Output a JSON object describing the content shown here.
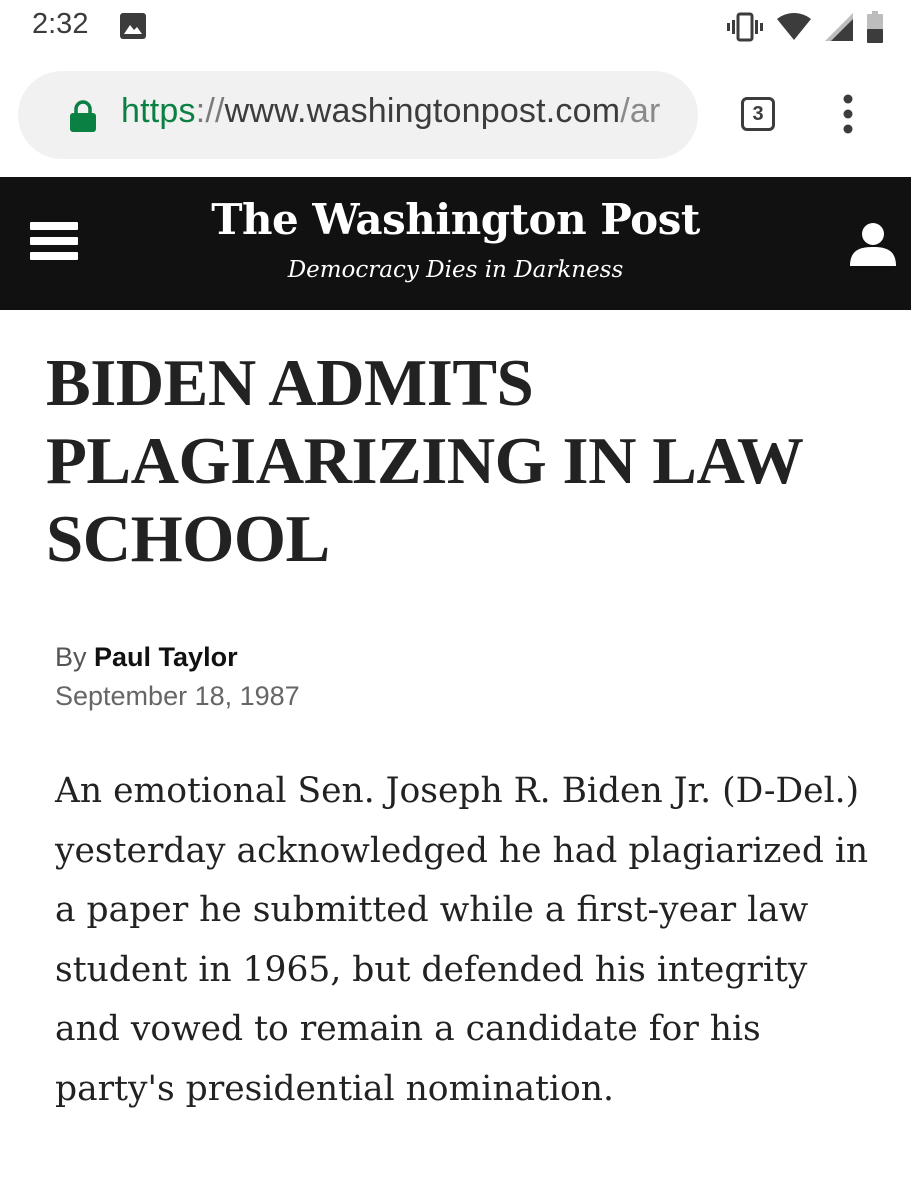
{
  "status_bar": {
    "time": "2:32",
    "icons": [
      "image-notification-icon",
      "vibrate-icon",
      "wifi-icon",
      "cell-signal-icon",
      "battery-icon"
    ]
  },
  "browser": {
    "url_scheme": "https",
    "url_separator": "://",
    "url_host": "www.washingtonpost.com",
    "url_path": "/ar",
    "tab_count": "3",
    "colors": {
      "secure": "#0b8043",
      "pill": "#f1f1f1"
    }
  },
  "masthead": {
    "logo": "The Washington Post",
    "tagline": "Democracy Dies in Darkness",
    "background": "#111111"
  },
  "article": {
    "headline": "BIDEN ADMITS PLAGIARIZING IN LAW SCHOOL",
    "byline_prefix": "By",
    "author": "Paul Taylor",
    "date": "September 18, 1987",
    "body": "An emotional Sen. Joseph R. Biden Jr. (D-Del.) yesterday acknowledged he had plagiarized in a paper he submitted while a first-year law student in 1965, but defended his integrity and vowed to remain a candidate for his party's presidential nomination."
  }
}
